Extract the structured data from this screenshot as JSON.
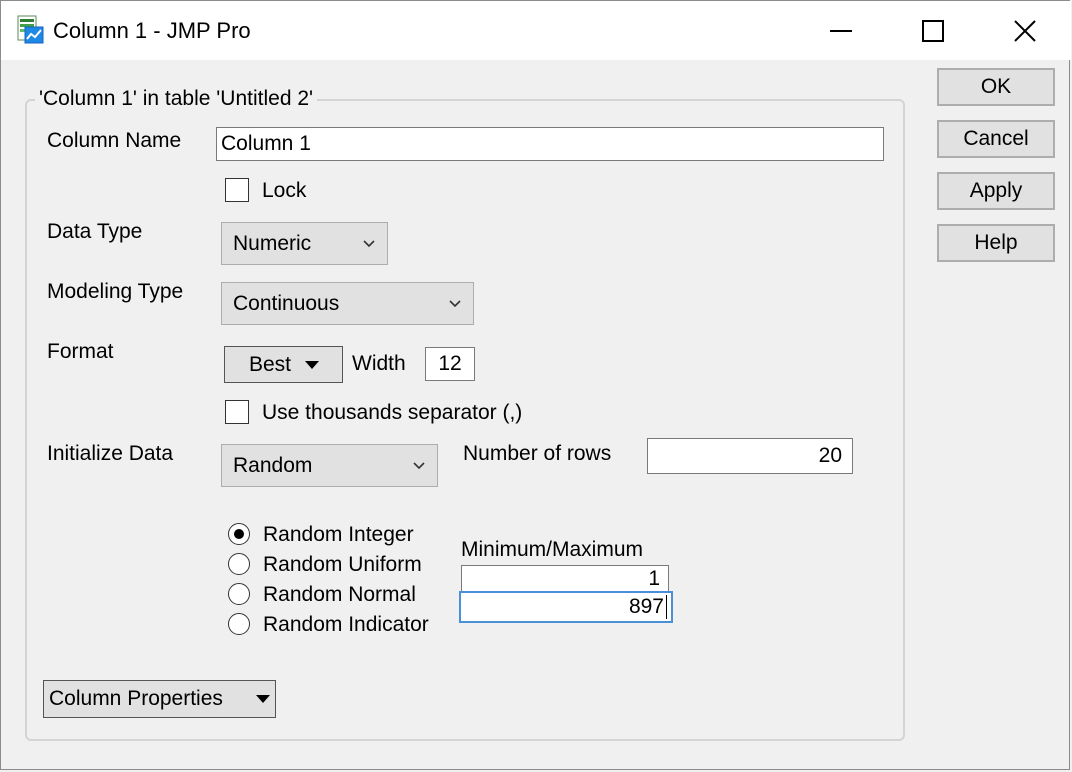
{
  "window": {
    "title": "Column 1 - JMP Pro",
    "icon": "jmp-app-icon",
    "controls": [
      "minimize-icon",
      "maximize-icon",
      "close-icon"
    ]
  },
  "group": {
    "legend": "'Column 1' in table 'Untitled 2'"
  },
  "column_name": {
    "label": "Column Name",
    "value": "Column 1"
  },
  "lock": {
    "label": "Lock",
    "checked": false
  },
  "data_type": {
    "label": "Data Type",
    "selected": "Numeric"
  },
  "modeling_type": {
    "label": "Modeling Type",
    "selected": "Continuous"
  },
  "format": {
    "label": "Format",
    "button": "Best",
    "width_label": "Width",
    "width_value": "12"
  },
  "thousands": {
    "label": "Use thousands separator (,)",
    "checked": false
  },
  "initialize": {
    "label": "Initialize Data",
    "selected": "Random",
    "rows_label": "Number of rows",
    "rows_value": "20"
  },
  "random": {
    "options": [
      "Random Integer",
      "Random Uniform",
      "Random Normal",
      "Random Indicator"
    ],
    "selected_index": 0,
    "minmax_label": "Minimum/Maximum",
    "minimum": "1",
    "maximum": "897"
  },
  "column_properties": {
    "label": "Column Properties"
  },
  "buttons": {
    "ok": "OK",
    "cancel": "Cancel",
    "apply": "Apply",
    "help": "Help"
  },
  "colors": {
    "focus_border": "#4a90d9",
    "button_face": "#e1e1e1",
    "dialog_bg": "#f0f0f0"
  }
}
